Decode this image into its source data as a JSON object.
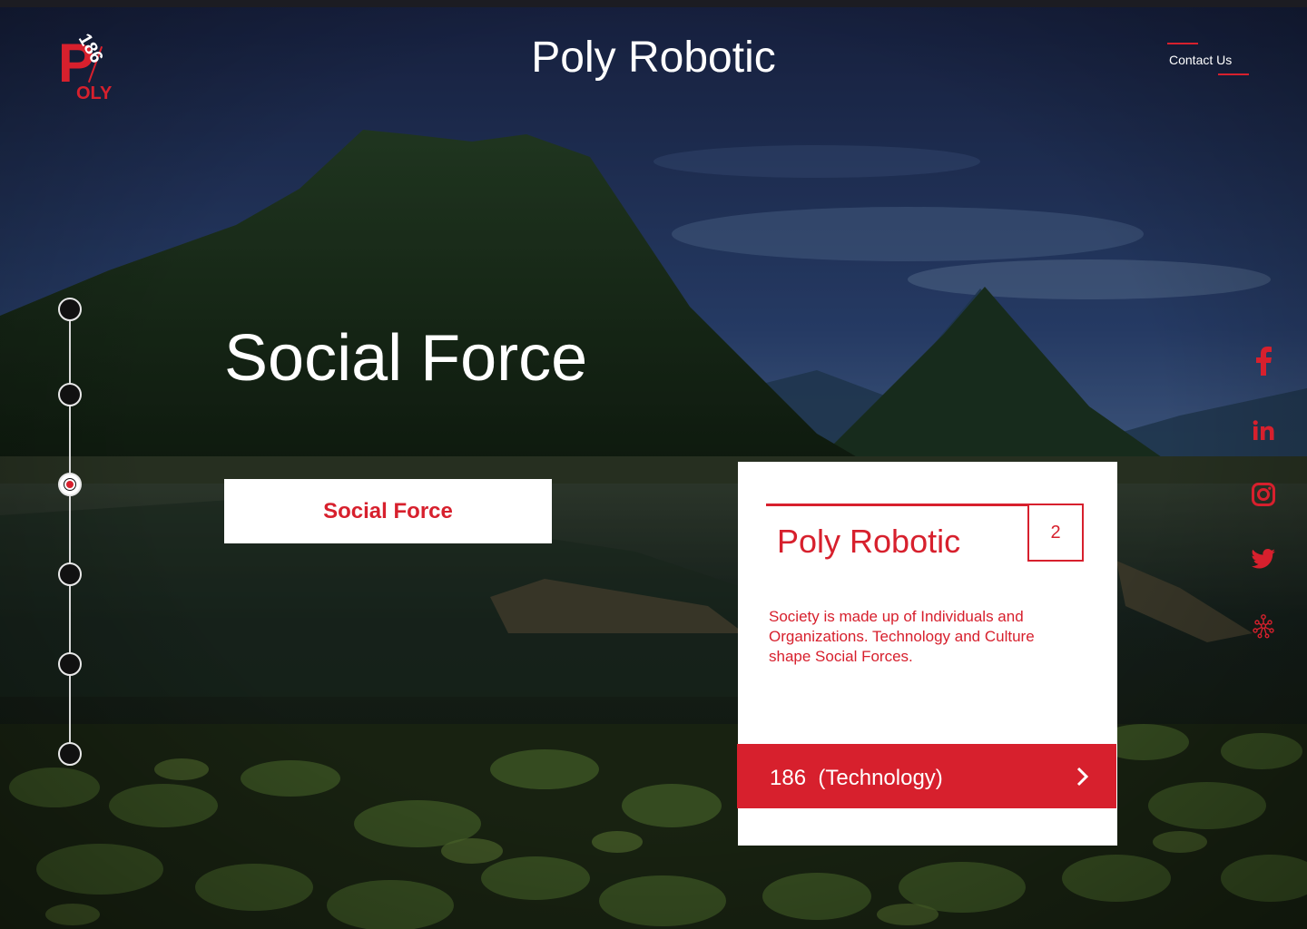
{
  "brand": {
    "logo_letter": "P",
    "logo_text": "OLY",
    "logo_number": "186",
    "title": "Poly Robotic"
  },
  "nav": {
    "contact_label": "Contact Us"
  },
  "hero": {
    "title": "Social Force",
    "button_label": "Social Force"
  },
  "timeline": {
    "steps": 6,
    "active_index": 2
  },
  "card": {
    "title": "Poly Robotic",
    "badge": "2",
    "description": "Society is made up of Individuals and Organizations. Technology and Culture shape Social Forces.",
    "footer_label": "186  (Technology)"
  },
  "social": [
    "facebook-icon",
    "linkedin-icon",
    "instagram-icon",
    "twitter-icon",
    "network-icon"
  ],
  "colors": {
    "accent": "#d7202d",
    "white": "#ffffff",
    "topbar": "#1c1c22"
  }
}
